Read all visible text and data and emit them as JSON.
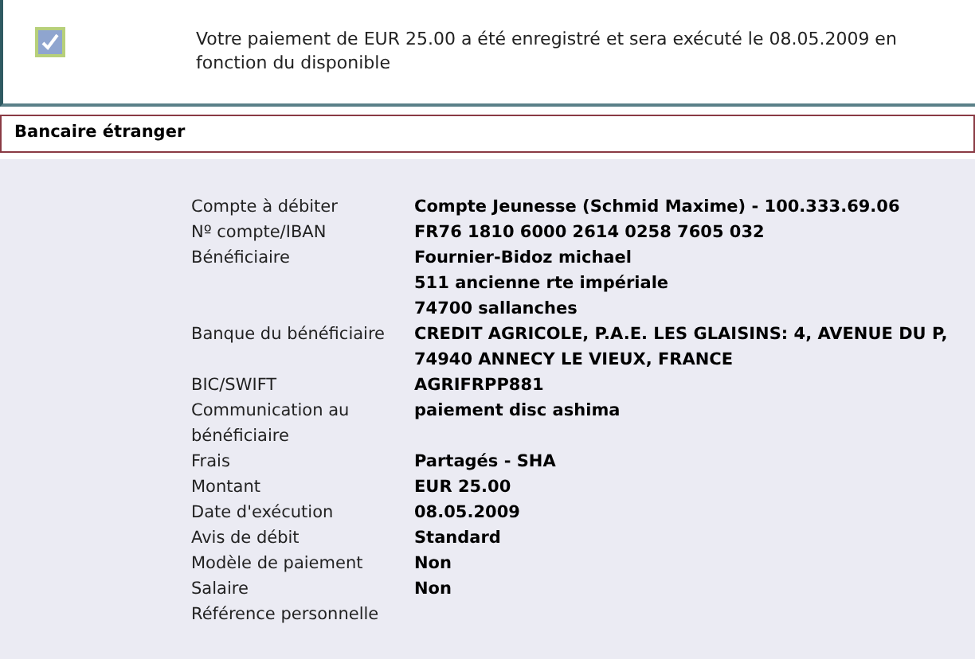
{
  "confirmation": {
    "message": "Votre paiement de EUR 25.00 a été enregistré et sera exécuté le 08.05.2009 en fonction du disponible"
  },
  "section": {
    "title": "Bancaire étranger"
  },
  "details": [
    {
      "label": "Compte à débiter",
      "values": [
        "Compte Jeunesse (Schmid Maxime) - 100.333.69.06"
      ]
    },
    {
      "label": "Nº compte/IBAN",
      "values": [
        "FR76 1810 6000 2614 0258 7605 032"
      ]
    },
    {
      "label": "Bénéficiaire",
      "values": [
        "Fournier-Bidoz michael",
        "511 ancienne rte impériale",
        "74700 sallanches"
      ]
    },
    {
      "label": "Banque du bénéficiaire",
      "values": [
        "CREDIT AGRICOLE, P.A.E. LES GLAISINS: 4, AVENUE DU P, 74940 ANNECY LE VIEUX, FRANCE"
      ]
    },
    {
      "label": "BIC/SWIFT",
      "values": [
        "AGRIFRPP881"
      ]
    },
    {
      "label": "Communication au bénéficiaire",
      "values": [
        "paiement disc ashima"
      ]
    },
    {
      "label": "Frais",
      "values": [
        "Partagés - SHA"
      ]
    },
    {
      "label": "Montant",
      "values": [
        "EUR 25.00"
      ]
    },
    {
      "label": "Date d'exécution",
      "values": [
        "08.05.2009"
      ]
    },
    {
      "label": "Avis de débit",
      "values": [
        "Standard"
      ]
    },
    {
      "label": "Modèle de paiement",
      "values": [
        "Non"
      ]
    },
    {
      "label": "Salaire",
      "values": [
        "Non"
      ]
    },
    {
      "label": "Référence personnelle"
    }
  ]
}
